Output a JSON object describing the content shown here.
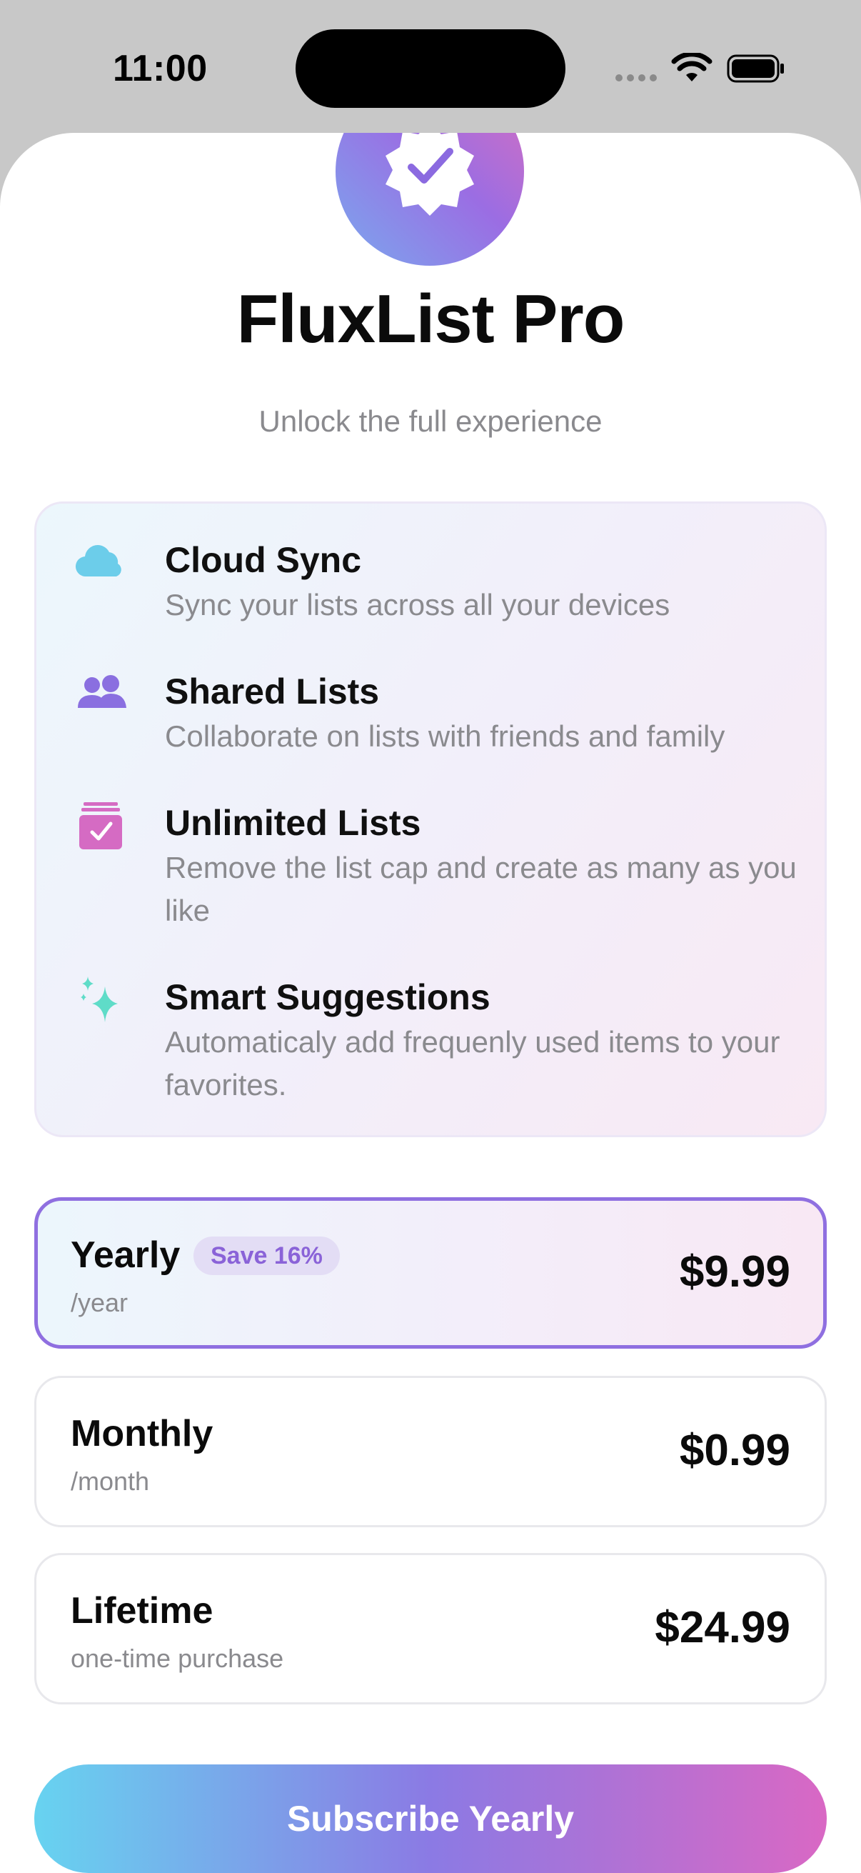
{
  "status_bar": {
    "time": "11:00"
  },
  "app": {
    "title": "FluxList Pro",
    "subtitle": "Unlock the full experience",
    "badge_icon": "verified-seal-icon"
  },
  "features": [
    {
      "icon": "cloud-icon",
      "title": "Cloud Sync",
      "description": "Sync your lists across all your devices"
    },
    {
      "icon": "people-icon",
      "title": "Shared Lists",
      "description": "Collaborate on lists with friends and family"
    },
    {
      "icon": "checklist-stack-icon",
      "title": "Unlimited Lists",
      "description": "Remove the list cap and create as many as you like"
    },
    {
      "icon": "sparkles-icon",
      "title": "Smart Suggestions",
      "description": "Automaticaly add frequenly used items to your favorites."
    }
  ],
  "plans": [
    {
      "name": "Yearly",
      "period": "/year",
      "price": "$9.99",
      "badge": "Save 16%",
      "selected": true
    },
    {
      "name": "Monthly",
      "period": "/month",
      "price": "$0.99",
      "selected": false
    },
    {
      "name": "Lifetime",
      "period": "one-time purchase",
      "price": "$24.99",
      "selected": false
    }
  ],
  "cta": {
    "label": "Subscribe Yearly"
  },
  "colors": {
    "accent_purple": "#8f6fe0",
    "gradient_start": "#67d3f0",
    "gradient_mid": "#8b7ae4",
    "gradient_end": "#d968c4",
    "cloud_icon": "#6ccdea",
    "people_icon": "#8a6fe0",
    "list_icon": "#d56bc3",
    "sparkle_icon": "#5fdcc8"
  }
}
